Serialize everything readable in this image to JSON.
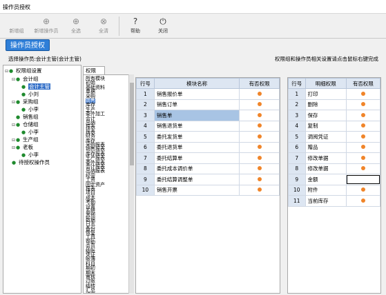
{
  "window": {
    "title": "操作员授权"
  },
  "toolbar": {
    "buttons": [
      {
        "label": "新增组",
        "icon": "",
        "name": "new-group"
      },
      {
        "label": "新增操作员",
        "icon": "⊕",
        "name": "new-operator"
      },
      {
        "label": "全选",
        "icon": "⊕",
        "name": "select-all"
      },
      {
        "label": "全清",
        "icon": "⊗",
        "name": "clear-all"
      },
      {
        "label": "帮助",
        "icon": "?",
        "name": "help"
      },
      {
        "label": "关闭",
        "icon": "⏻",
        "name": "close"
      }
    ]
  },
  "header": {
    "title": "操作员授权"
  },
  "operator_line": "选择操作员:会计主管(会计主管)",
  "hint": "权限组和操作员相关设置请点击鼠标右键完成",
  "tree": [
    {
      "label": "权限组设置",
      "toggle": "⊟"
    },
    {
      "label": "会计组",
      "toggle": "⊟"
    },
    {
      "label": "会计主管",
      "toggle": ""
    },
    {
      "label": "小刘",
      "toggle": ""
    },
    {
      "label": "采购组",
      "toggle": "⊟"
    },
    {
      "label": "小李",
      "toggle": ""
    },
    {
      "label": "销售组",
      "toggle": ""
    },
    {
      "label": "仓储组",
      "toggle": "⊟"
    },
    {
      "label": "小李",
      "toggle": ""
    },
    {
      "label": "生产组",
      "toggle": "⊟"
    },
    {
      "label": "老板",
      "toggle": "⊟"
    },
    {
      "label": "小李",
      "toggle": ""
    },
    {
      "label": "待授权操作员",
      "toggle": ""
    }
  ],
  "tab_label": "权限",
  "module_list": [
    "所有模块",
    "初始",
    "基础资料",
    "单据",
    "采购",
    "销售",
    "库存",
    "生产",
    "委外加工",
    "会计",
    "出纳",
    "报表",
    "报表",
    "财务",
    "库存",
    "采购报表",
    "销售报表",
    "库存报表",
    "生产报表",
    "委外报表",
    "会计报表",
    "出纳报表",
    "经营",
    "工资",
    "固定资产",
    "报表",
    "项目",
    "成本",
    "考勤",
    "设置",
    "系统",
    "其他",
    "数据",
    "日志",
    "备份",
    "恢复",
    "工具",
    "帮助",
    "会员",
    "结账",
    "凭证",
    "账簿",
    "科目",
    "期初",
    "期末",
    "审核",
    "过账",
    "结转",
    "汇总",
    "打印"
  ],
  "module_selected": "销售",
  "grid1": {
    "headers": [
      "行号",
      "模块名称",
      "有否权限"
    ],
    "rows": [
      {
        "no": "1",
        "name": "销售报价单"
      },
      {
        "no": "2",
        "name": "销售订单"
      },
      {
        "no": "3",
        "name": "销售单"
      },
      {
        "no": "4",
        "name": "销售退货单"
      },
      {
        "no": "5",
        "name": "委托发货单"
      },
      {
        "no": "6",
        "name": "委托退货单"
      },
      {
        "no": "7",
        "name": "委托结算单"
      },
      {
        "no": "8",
        "name": "委托成本调价单"
      },
      {
        "no": "9",
        "name": "委托结算调整单"
      },
      {
        "no": "10",
        "name": "销售开票"
      }
    ]
  },
  "grid2": {
    "headers": [
      "行号",
      "明细权限",
      "有否权限"
    ],
    "rows": [
      {
        "no": "1",
        "name": "打印"
      },
      {
        "no": "2",
        "name": "删除"
      },
      {
        "no": "3",
        "name": "保存"
      },
      {
        "no": "4",
        "name": "复制"
      },
      {
        "no": "5",
        "name": "调阅凭证"
      },
      {
        "no": "6",
        "name": "赠品"
      },
      {
        "no": "7",
        "name": "修改单据"
      },
      {
        "no": "8",
        "name": "修改单据"
      },
      {
        "no": "9",
        "name": "金额"
      },
      {
        "no": "10",
        "name": "附件"
      },
      {
        "no": "11",
        "name": "当前库存"
      }
    ]
  },
  "colors": {
    "accent": "#2f7fd8",
    "dot": "#f0852a",
    "selected_row": "#a8c4e4"
  }
}
